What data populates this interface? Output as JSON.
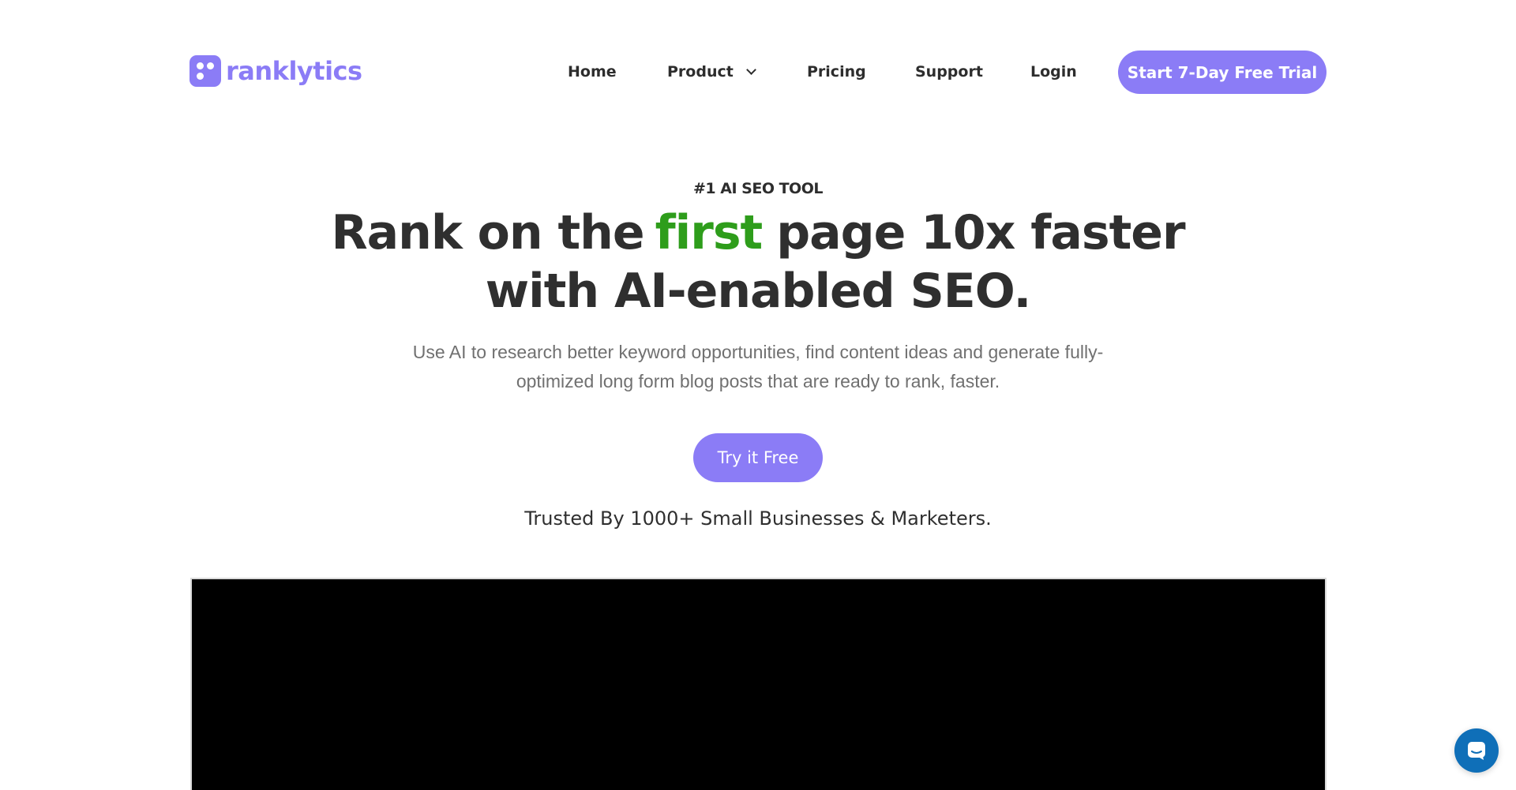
{
  "brand": {
    "name": "ranklytics",
    "color": "#8b7cf6"
  },
  "nav": {
    "items": [
      {
        "label": "Home"
      },
      {
        "label": "Product",
        "icon": "chevron-down-icon"
      },
      {
        "label": "Pricing"
      },
      {
        "label": "Support"
      },
      {
        "label": "Login"
      }
    ],
    "cta_label": "Start 7-Day Free Trial"
  },
  "hero": {
    "eyebrow": "#1 AI SEO TOOL",
    "headline_part1": "Rank on the",
    "headline_accent": "first",
    "headline_part2": "page 10x faster",
    "headline_line2": "with AI-enabled SEO.",
    "accent_color": "#2e9d1b",
    "subtext": "Use AI to research better keyword opportunities, find content ideas and generate fully-optimized long form blog posts that are ready to rank, faster.",
    "cta_label": "Try it Free",
    "trusted": "Trusted By 1000+ Small Businesses & Marketers."
  },
  "video": {
    "background": "#000000"
  },
  "chat_widget": {
    "icon": "chat-icon",
    "color": "#0f6fb8"
  }
}
